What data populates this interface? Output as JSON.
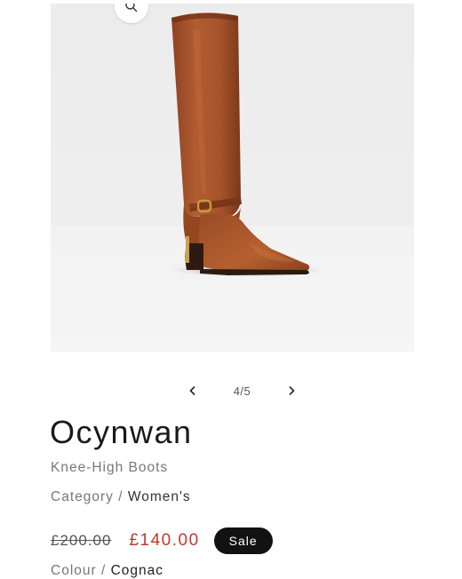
{
  "product": {
    "title": "Ocynwan",
    "subtitle": "Knee-High Boots",
    "category_label": "Category",
    "category_separator": "/",
    "category_value": "Women's",
    "old_price": "£200.00",
    "new_price": "£140.00",
    "sale_badge": "Sale",
    "colour_label": "Colour",
    "colour_separator": "/",
    "colour_value": "Cognac"
  },
  "gallery": {
    "counter": "4/5",
    "current_index": 4,
    "total": 5,
    "zoom_icon": "zoom-icon",
    "prev_icon": "chevron-left-icon",
    "next_icon": "chevron-right-icon"
  },
  "colors": {
    "sale_price": "#c0392b",
    "badge_bg": "#121212",
    "boot": "#a0522d"
  }
}
